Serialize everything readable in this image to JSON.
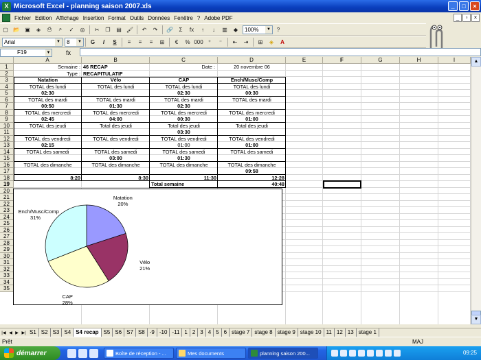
{
  "window": {
    "title": "Microsoft Excel - planning saison 2007.xls"
  },
  "menu": [
    "Fichier",
    "Edition",
    "Affichage",
    "Insertion",
    "Format",
    "Outils",
    "Données",
    "Fenêtre",
    "?",
    "Adobe PDF"
  ],
  "toolbar": {
    "zoom": "100%",
    "font": "Arial",
    "size": "8",
    "bold": "G",
    "italic": "I",
    "underline": "S",
    "sum": "Σ",
    "fx_btn": "fx",
    "percent": "%",
    "thousands": "000"
  },
  "formula": {
    "namebox": "F19",
    "fx": "fx",
    "content": ""
  },
  "columns": [
    "A",
    "B",
    "C",
    "D",
    "E",
    "F",
    "G",
    "H",
    "I"
  ],
  "rows": [
    "1",
    "2",
    "3",
    "4",
    "5",
    "6",
    "7",
    "8",
    "9",
    "10",
    "11",
    "12",
    "13",
    "14",
    "15",
    "16",
    "17",
    "18",
    "19",
    "20",
    "21",
    "22",
    "23",
    "24",
    "25",
    "26",
    "27",
    "28",
    "29",
    "30",
    "31",
    "32",
    "33",
    "34",
    "35"
  ],
  "sheet": {
    "a1": "Semaine :",
    "b1": "46 RECAP",
    "c1": "Date :",
    "d1": "20 novembre 06",
    "a2": "Type :",
    "b2": "RECAPITULATIF",
    "h": [
      "Natation",
      "Vélo",
      "CAP",
      "Ench/Musc/Comp"
    ],
    "r4": [
      "TOTAL des lundi",
      "TOTAL des lundi",
      "TOTAL des lundi",
      "TOTAL des lundi"
    ],
    "r5": [
      "02:30",
      "",
      "02:30",
      "00:30"
    ],
    "r6": [
      "TOTAL des mardi",
      "TOTAL des mardi",
      "TOTAL des mardi",
      "TOTAL des mardi"
    ],
    "r7": [
      "00:50",
      "01:30",
      "02:30",
      ""
    ],
    "r8": [
      "TOTAL des mercredi",
      "TOTAL des mercredi",
      "TOTAL des mercredi",
      "TOTAL des mercredi"
    ],
    "r9": [
      "02:45",
      "04:00",
      "00:30",
      "01:00"
    ],
    "r10": [
      "TOTAL des jeudi",
      "Total des jeudi",
      "Total des jeudi",
      "Total des jeudi"
    ],
    "r11": [
      "",
      "",
      "03:30",
      ""
    ],
    "r12": [
      "TOTAL des vendredi",
      "TOTAL des vendredi",
      "TOTAL des vendredi",
      "TOTAL des vendredi"
    ],
    "r13": [
      "02:15",
      "",
      "01:00",
      "01:00"
    ],
    "r14": [
      "TOTAL des samedi",
      "TOTAL des samedi",
      "TOTAL des samedi",
      "TOTAL des samedi"
    ],
    "r15": [
      "",
      "03:00",
      "01:30",
      ""
    ],
    "r16": [
      "TOTAL des dimanche",
      "TOTAL des dimanche",
      "TOTAL des dimanche",
      "TOTAL des dimanche"
    ],
    "r17": [
      "",
      "",
      "",
      "09:58"
    ],
    "r18": [
      "8:20",
      "8:30",
      "11:30",
      "12:28"
    ],
    "r19_label": "Total semaine",
    "r19_value": "40:48"
  },
  "chart_data": {
    "type": "pie",
    "categories": [
      "Natation",
      "Vélo",
      "CAP",
      "Ench/Musc/Comp"
    ],
    "values": [
      20,
      21,
      28,
      31
    ],
    "labels": [
      "20%",
      "21%",
      "28%",
      "31%"
    ],
    "colors": [
      "#9999ff",
      "#993366",
      "#ffffcc",
      "#ccffff"
    ]
  },
  "tabs": [
    "S1",
    "S2",
    "S3",
    "S4",
    "S4 recap",
    "S5",
    "S6",
    "S7",
    "S8",
    "-9",
    "-10",
    "-11",
    "1",
    "2",
    "3",
    "4",
    "5",
    "6",
    "stage 7",
    "stage 8",
    "stage 9",
    "stage 10",
    "11",
    "12",
    "13",
    "stage 1"
  ],
  "status": {
    "left": "Prêt",
    "caps": "MAJ"
  },
  "taskbar": {
    "start": "démarrer",
    "tasks": [
      "Boîte de réception - ...",
      "Mes documents",
      "planning saison 200..."
    ],
    "clock": "09:25"
  }
}
